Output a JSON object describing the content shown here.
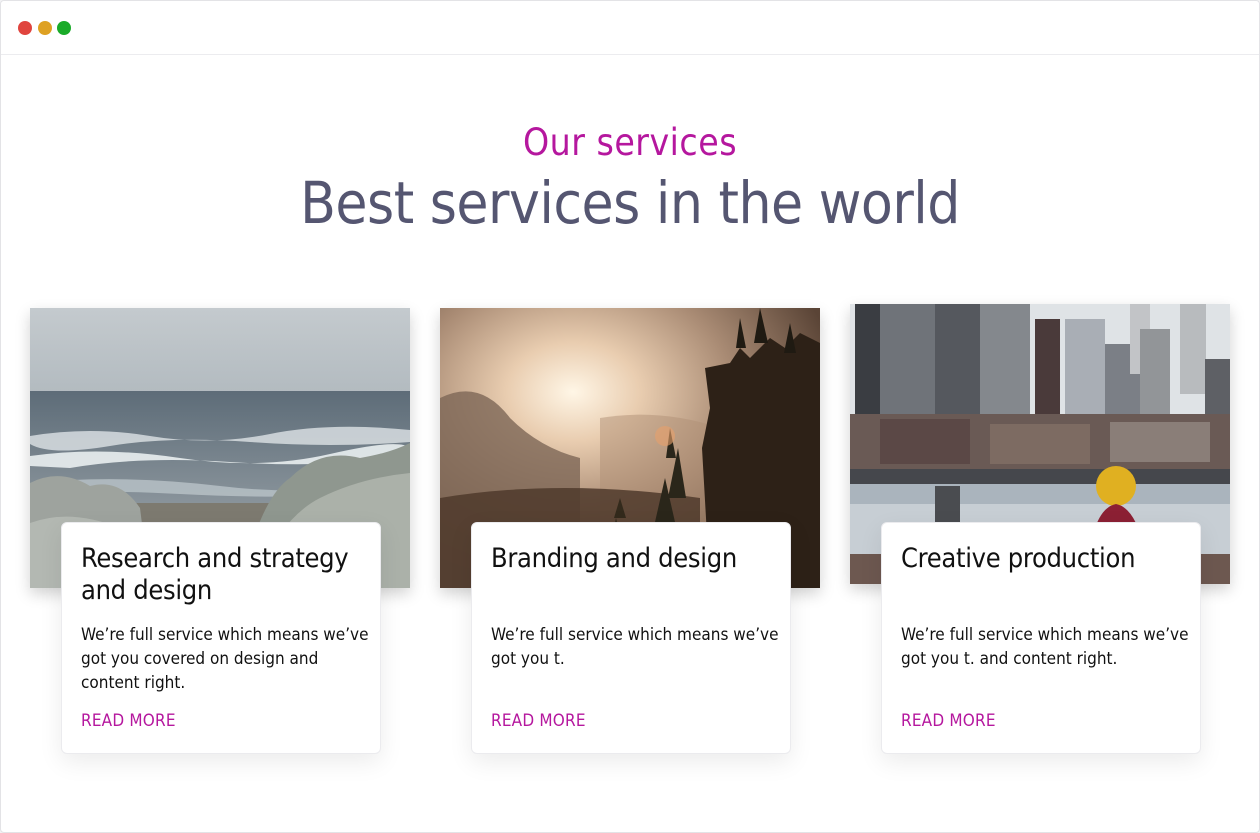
{
  "colors": {
    "accent": "#b5179e",
    "heading": "#555671",
    "dot_red": "#e0443e",
    "dot_yellow": "#dea123",
    "dot_green": "#1aab29"
  },
  "window": {
    "controls": [
      "close-dot",
      "minimize-dot",
      "maximize-dot"
    ]
  },
  "section": {
    "eyebrow": "Our services",
    "headline": "Best services in the world"
  },
  "cards": [
    {
      "image": "ocean-shore-photo",
      "title": "Research and strategy and design",
      "text": "We’re full service which means we’ve got you covered on design and content right.",
      "link": "READ MORE"
    },
    {
      "image": "forest-sunrise-photo",
      "title": "Branding and design",
      "text": "We’re full service which means we’ve got you t.",
      "link": "READ MORE"
    },
    {
      "image": "city-skyline-photo",
      "title": "Creative production",
      "text": "We’re full service which means we’ve got you t. and content right.",
      "link": "READ MORE"
    }
  ]
}
